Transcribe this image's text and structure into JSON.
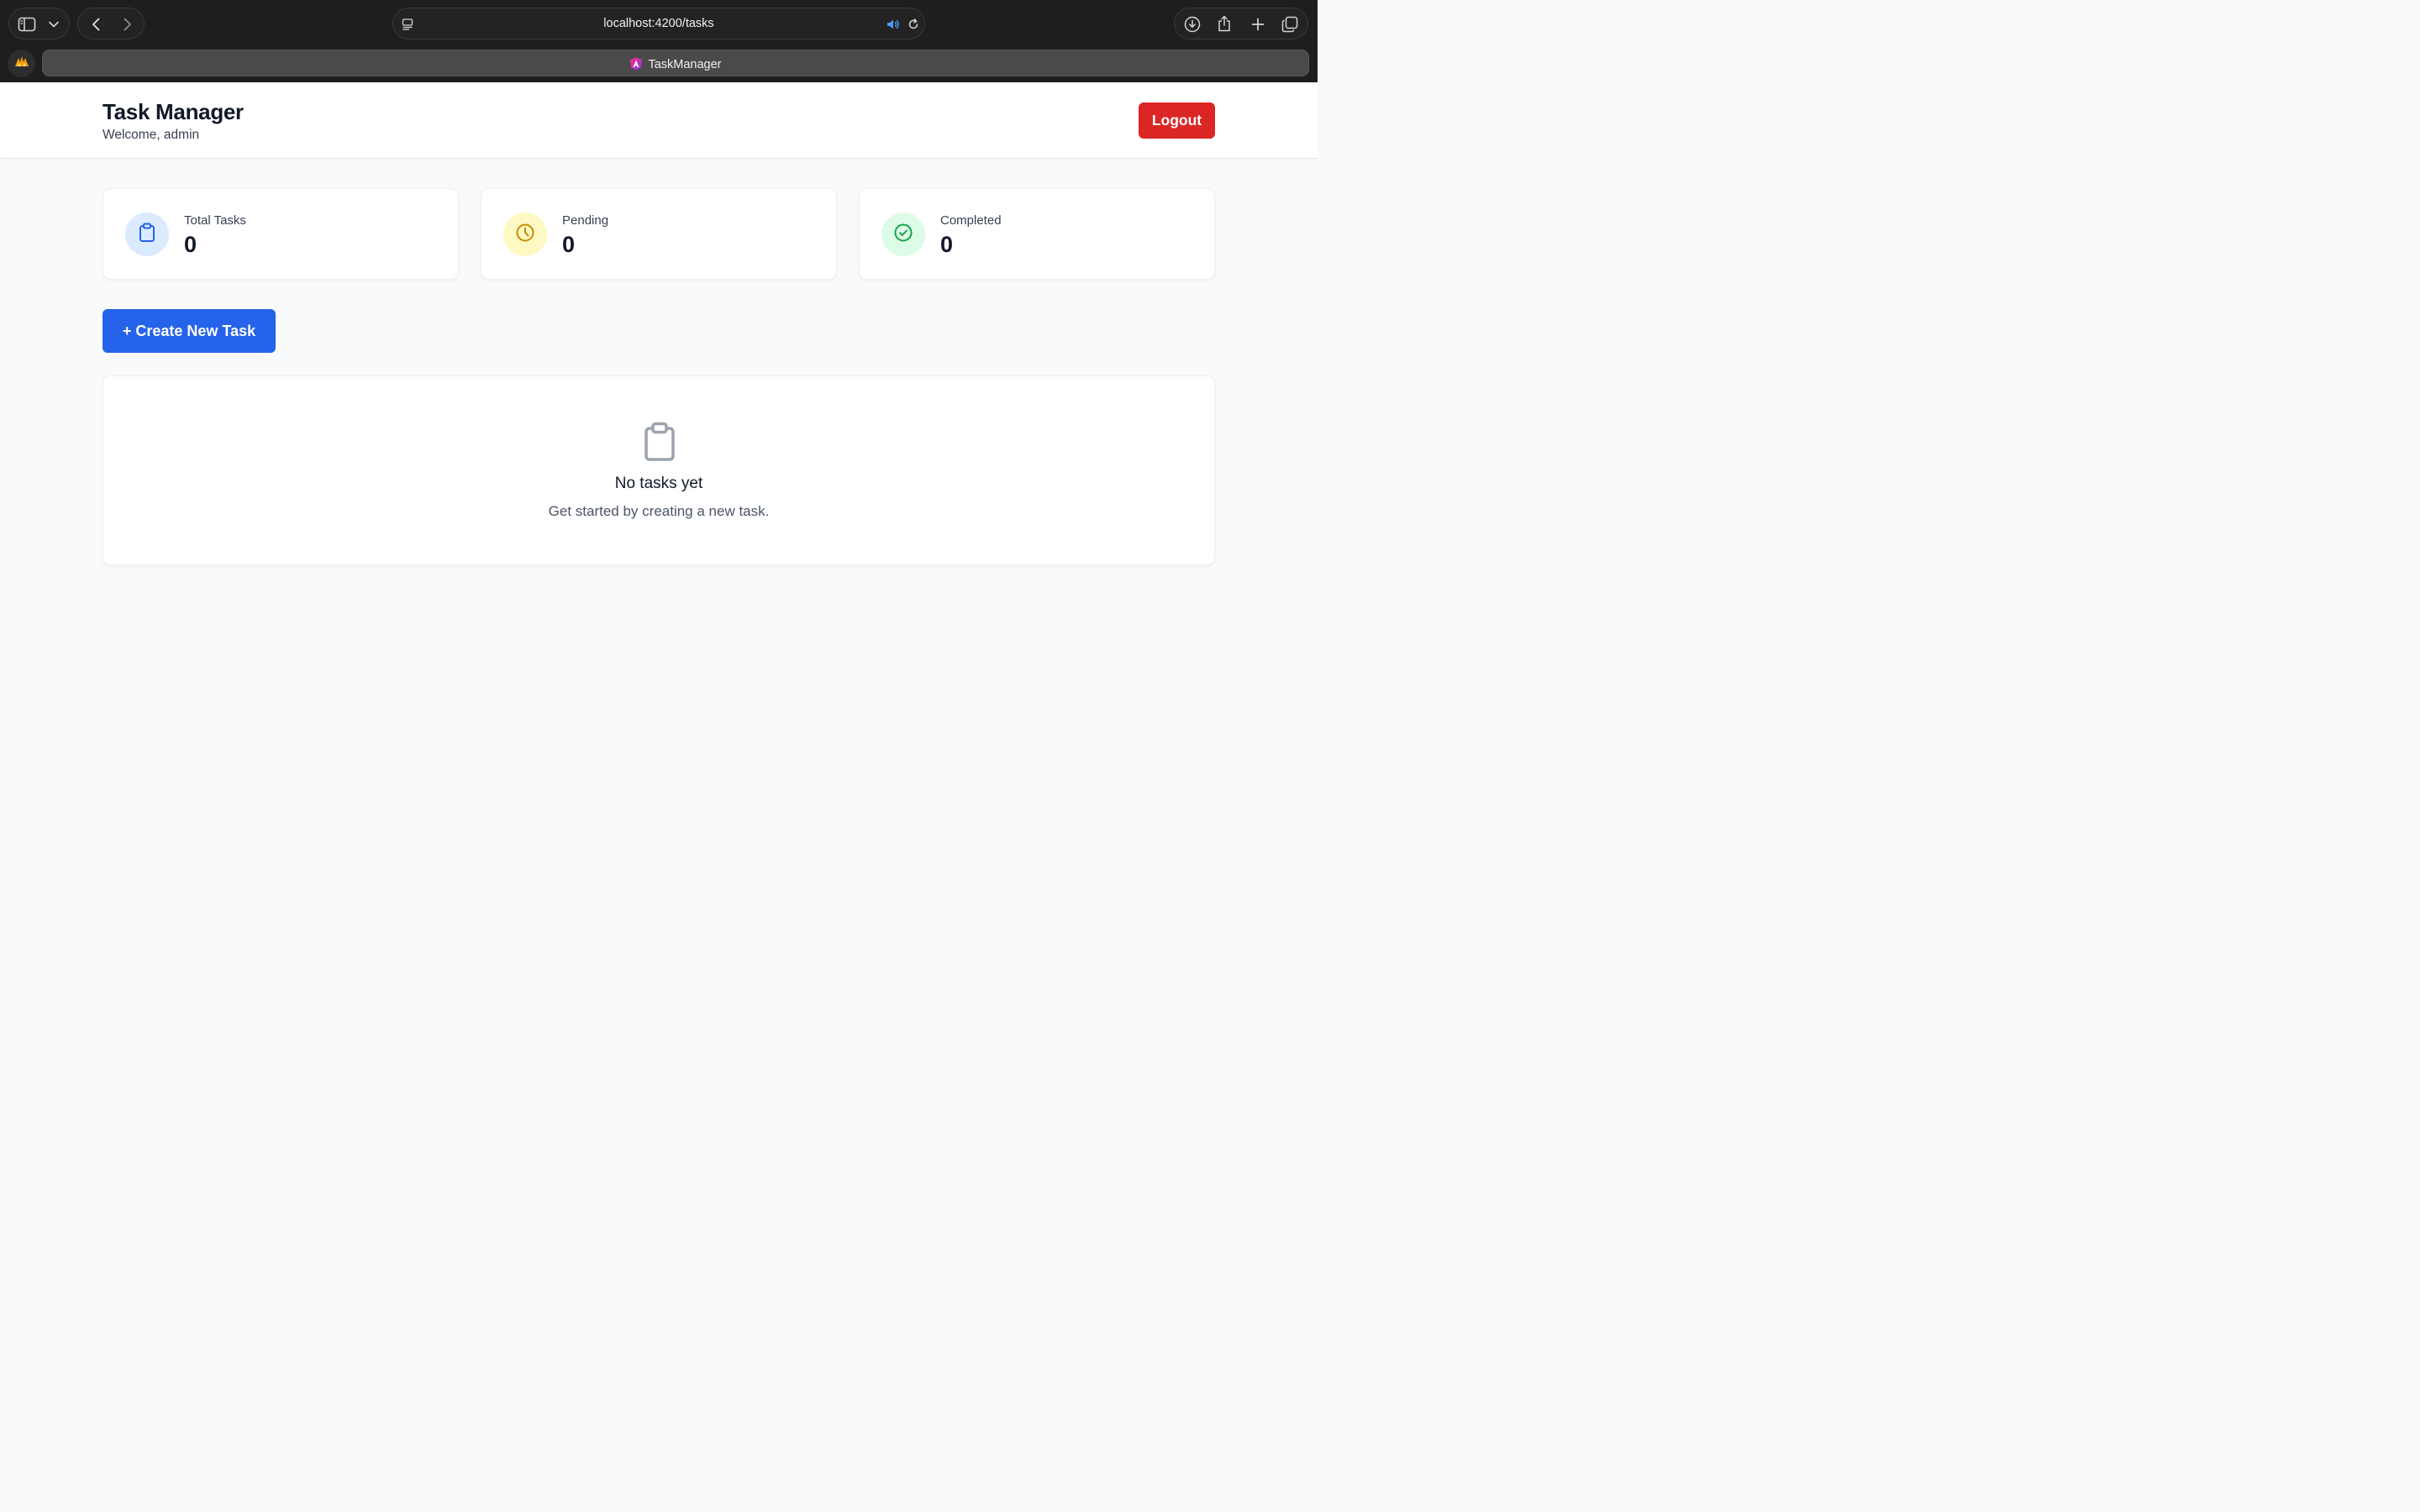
{
  "browser": {
    "url": "localhost:4200/tasks",
    "tab_title": "TaskManager"
  },
  "header": {
    "title": "Task Manager",
    "welcome": "Welcome, admin",
    "logout_label": "Logout"
  },
  "stats": [
    {
      "label": "Total Tasks",
      "value": "0",
      "icon": "clipboard-icon",
      "color": "#2563eb",
      "bg": "#dbeafe"
    },
    {
      "label": "Pending",
      "value": "0",
      "icon": "clock-icon",
      "color": "#ca8a04",
      "bg": "#fef9c3"
    },
    {
      "label": "Completed",
      "value": "0",
      "icon": "check-circle-icon",
      "color": "#16a34a",
      "bg": "#dcfce7"
    }
  ],
  "actions": {
    "create_label": "+ Create New Task"
  },
  "empty_state": {
    "icon": "clipboard-icon",
    "title": "No tasks yet",
    "subtitle": "Get started by creating a new task."
  },
  "colors": {
    "primary": "#2563eb",
    "danger": "#dc2626"
  }
}
